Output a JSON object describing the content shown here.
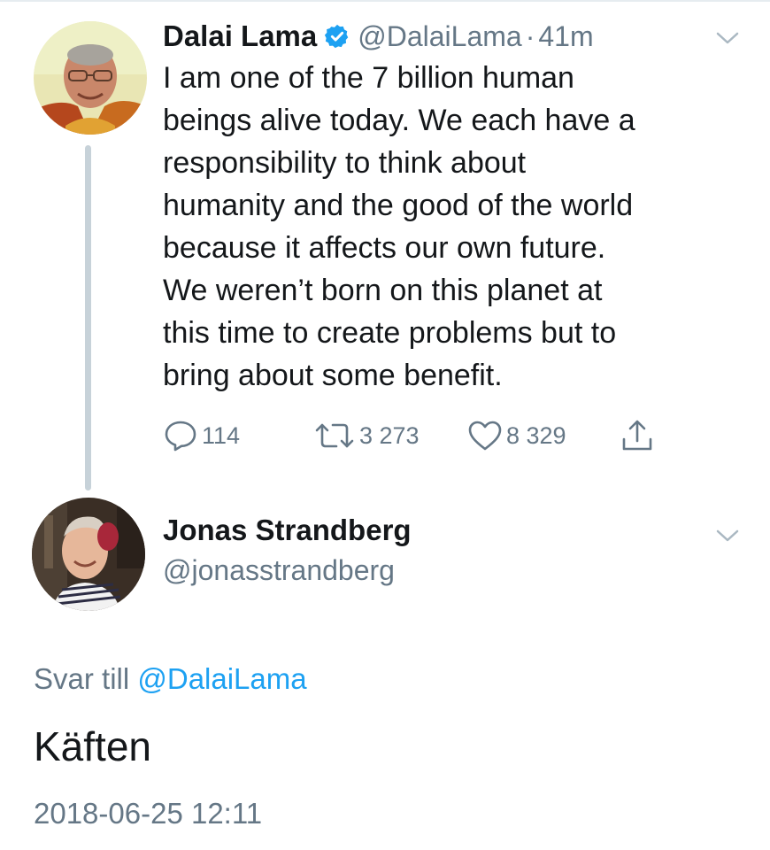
{
  "tweet": {
    "author_name": "Dalai Lama",
    "verified": true,
    "handle": "@DalaiLama",
    "separator": "·",
    "time_ago": "41m",
    "text": "I am one of the 7 billion human\nbeings alive today. We each have a\nresponsibility to think about\nhumanity and the good of the world\nbecause it affects our own future.\nWe weren’t born on this planet at\nthis time to create problems but to\nbring about some benefit.",
    "stats": {
      "replies": "114",
      "retweets": "3 273",
      "likes": "8 329"
    }
  },
  "reply": {
    "author_name": "Jonas Strandberg",
    "handle": "@jonasstrandberg",
    "reply_to_prefix": "Svar till",
    "reply_to_handle": "@DalaiLama",
    "text": "Käften",
    "timestamp": "2018-06-25 12:11"
  },
  "colors": {
    "text": "#14171a",
    "secondary": "#657786",
    "link": "#1da1f2",
    "verified": "#1da1f2",
    "thread_line": "#c7d2d9"
  },
  "icons": {
    "verified": "verified-badge-icon",
    "menu": "chevron-down-icon",
    "reply": "reply-bubble-icon",
    "retweet": "retweet-icon",
    "like": "heart-icon",
    "share": "share-upload-icon"
  }
}
